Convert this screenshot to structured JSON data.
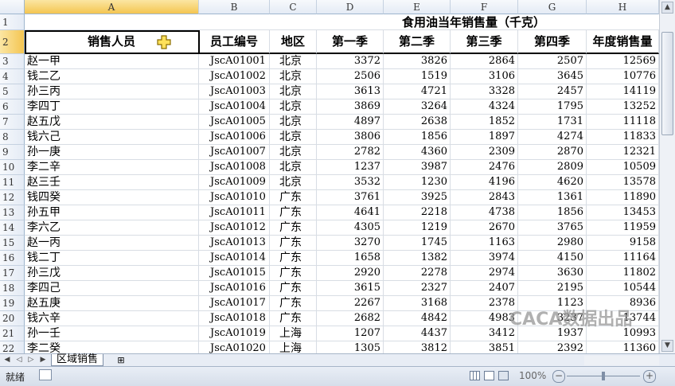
{
  "columns": [
    "A",
    "B",
    "C",
    "D",
    "E",
    "F",
    "G",
    "H"
  ],
  "title": "食用油当年销售量（千克）",
  "headers": [
    "销售人员",
    "员工编号",
    "地区",
    "第一季",
    "第二季",
    "第三季",
    "第四季",
    "年度销售量"
  ],
  "rows": [
    [
      "3",
      "赵一甲",
      "JscA01001",
      "北京",
      "3372",
      "3826",
      "2864",
      "2507",
      "12569"
    ],
    [
      "4",
      "钱二乙",
      "JscA01002",
      "北京",
      "2506",
      "1519",
      "3106",
      "3645",
      "10776"
    ],
    [
      "5",
      "孙三丙",
      "JscA01003",
      "北京",
      "3613",
      "4721",
      "3328",
      "2457",
      "14119"
    ],
    [
      "6",
      "李四丁",
      "JscA01004",
      "北京",
      "3869",
      "3264",
      "4324",
      "1795",
      "13252"
    ],
    [
      "7",
      "赵五戊",
      "JscA01005",
      "北京",
      "4897",
      "2638",
      "1852",
      "1731",
      "11118"
    ],
    [
      "8",
      "钱六己",
      "JscA01006",
      "北京",
      "3806",
      "1856",
      "1897",
      "4274",
      "11833"
    ],
    [
      "9",
      "孙一庚",
      "JscA01007",
      "北京",
      "2782",
      "4360",
      "2309",
      "2870",
      "12321"
    ],
    [
      "10",
      "李二辛",
      "JscA01008",
      "北京",
      "1237",
      "3987",
      "2476",
      "2809",
      "10509"
    ],
    [
      "11",
      "赵三壬",
      "JscA01009",
      "北京",
      "3532",
      "1230",
      "4196",
      "4620",
      "13578"
    ],
    [
      "12",
      "钱四癸",
      "JscA01010",
      "广东",
      "3761",
      "3925",
      "2843",
      "1361",
      "11890"
    ],
    [
      "13",
      "孙五甲",
      "JscA01011",
      "广东",
      "4641",
      "2218",
      "4738",
      "1856",
      "13453"
    ],
    [
      "14",
      "李六乙",
      "JscA01012",
      "广东",
      "4305",
      "1219",
      "2670",
      "3765",
      "11959"
    ],
    [
      "15",
      "赵一丙",
      "JscA01013",
      "广东",
      "3270",
      "1745",
      "1163",
      "2980",
      "9158"
    ],
    [
      "16",
      "钱二丁",
      "JscA01014",
      "广东",
      "1658",
      "1382",
      "3974",
      "4150",
      "11164"
    ],
    [
      "17",
      "孙三戊",
      "JscA01015",
      "广东",
      "2920",
      "2278",
      "2974",
      "3630",
      "11802"
    ],
    [
      "18",
      "李四己",
      "JscA01016",
      "广东",
      "3615",
      "2327",
      "2407",
      "2195",
      "10544"
    ],
    [
      "19",
      "赵五庚",
      "JscA01017",
      "广东",
      "2267",
      "3168",
      "2378",
      "1123",
      "8936"
    ],
    [
      "20",
      "钱六辛",
      "JscA01018",
      "广东",
      "2682",
      "4842",
      "4983",
      "3237",
      "13744"
    ],
    [
      "21",
      "孙一壬",
      "JscA01019",
      "上海",
      "1207",
      "4437",
      "3412",
      "1937",
      "10993"
    ],
    [
      "22",
      "李二癸",
      "JscA01020",
      "上海",
      "1305",
      "3812",
      "3851",
      "2392",
      "11360"
    ]
  ],
  "sheet_tab": "区域销售",
  "status": "就绪",
  "zoom": "100%",
  "watermark": "CACA数据出品",
  "row_numbers_top": [
    "1",
    "2"
  ]
}
